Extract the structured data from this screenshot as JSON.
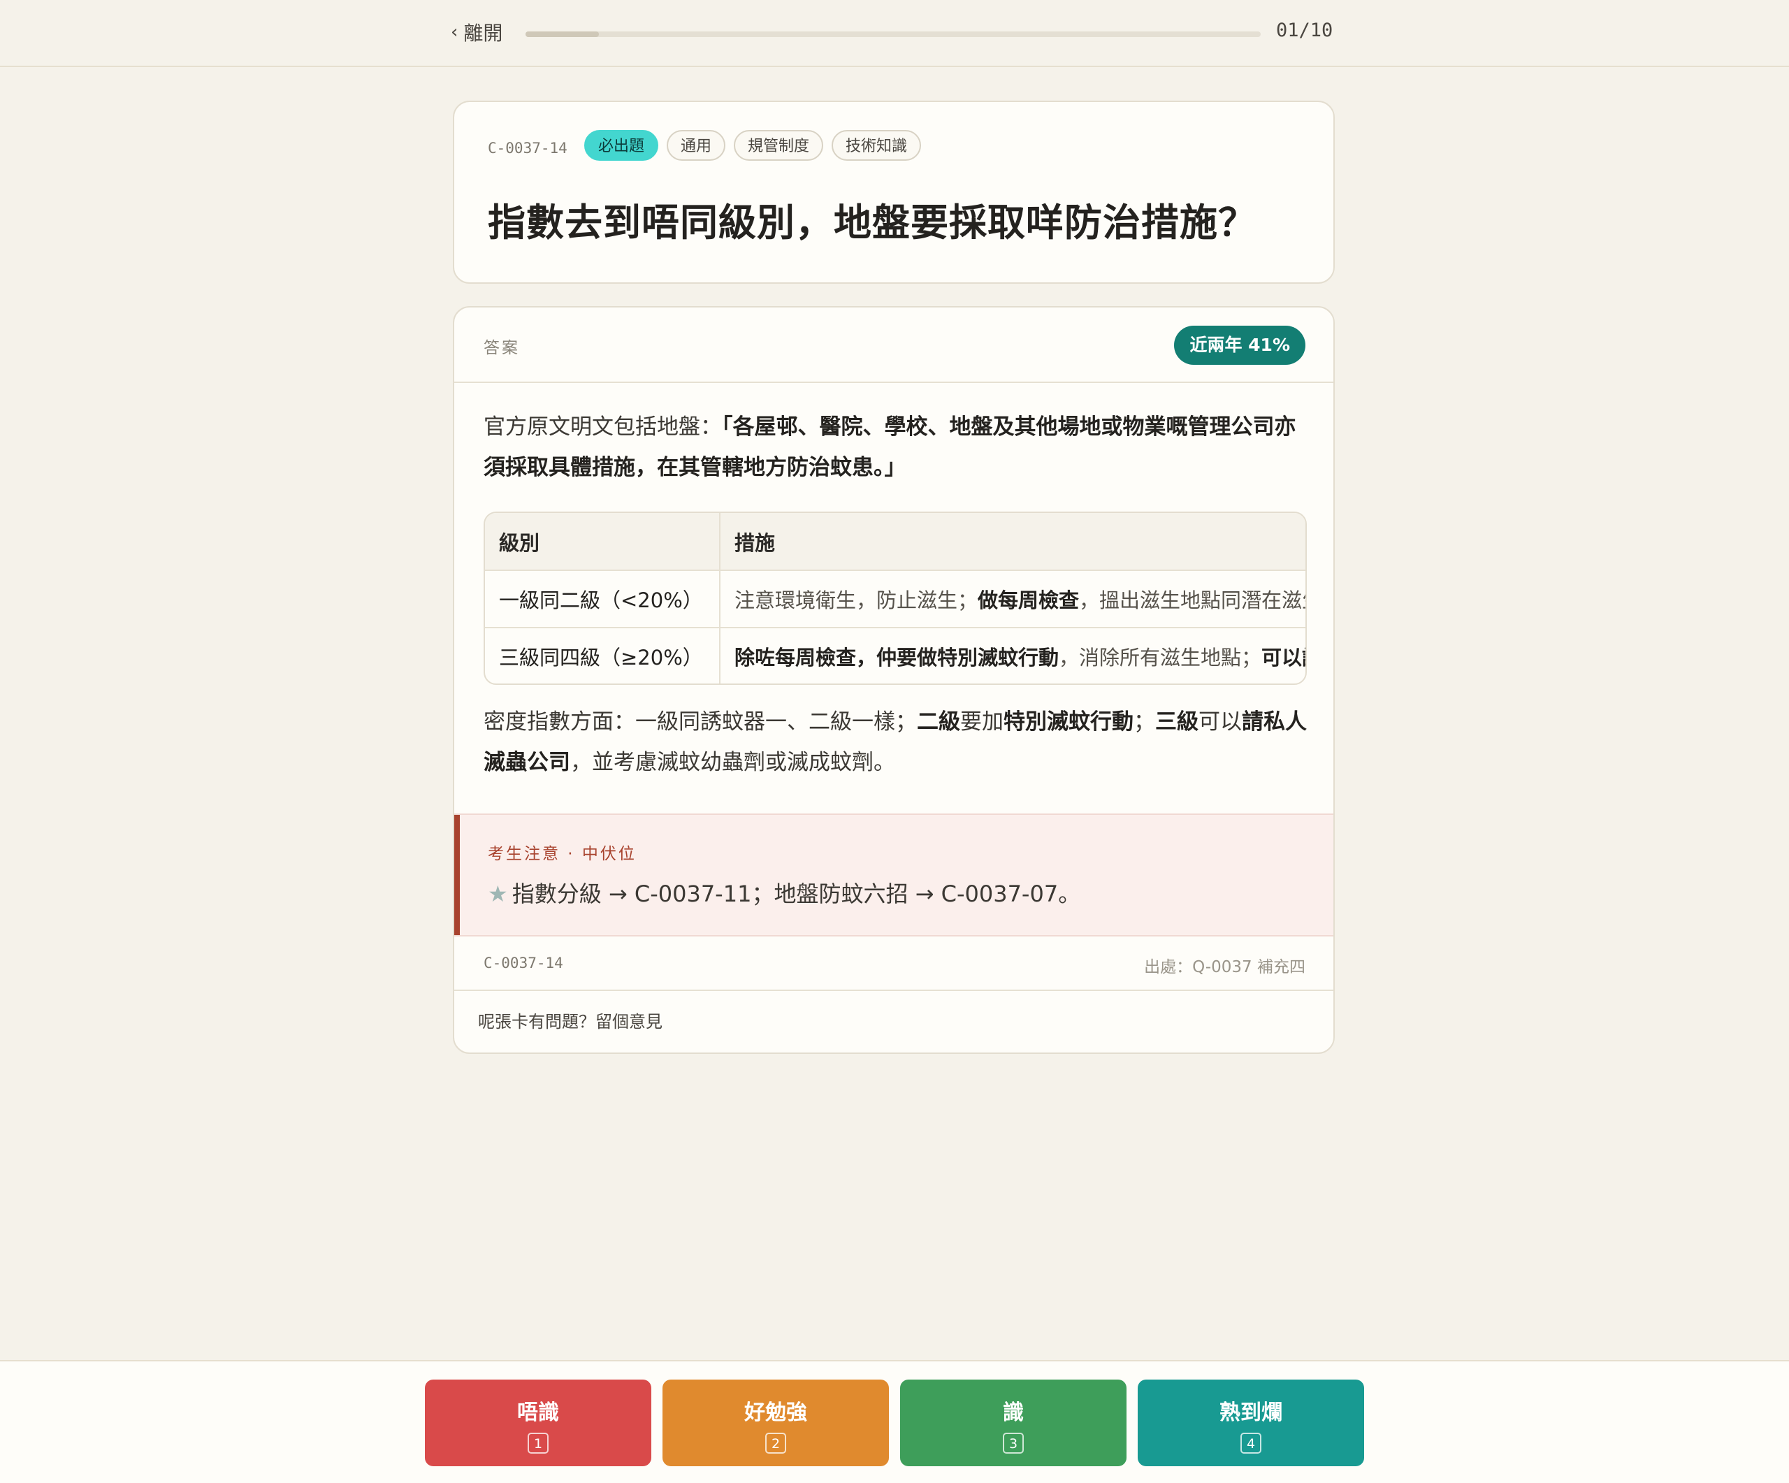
{
  "topbar": {
    "back_label": "離開",
    "progress_counter": "01/10",
    "progress_fraction": 0.1
  },
  "question": {
    "card_id": "C-0037-14",
    "tags": [
      "必出題",
      "通用",
      "規管制度",
      "技術知識"
    ],
    "title": "指數去到唔同級別，地盤要採取咩防治措施？"
  },
  "answer": {
    "label": "答案",
    "rate_badge": "近兩年 41%",
    "para1": {
      "lead": "官方原文明文包括地盤：",
      "quote": "「各屋邨、醫院、學校、地盤及其他場地或物業嘅管理公司亦須採取具體措施，在其管轄地方防治蚊患。」"
    },
    "table": {
      "headers": [
        "級別",
        "措施"
      ],
      "rows": [
        {
          "level": "一級同二級（<20%）",
          "m1": "注意環境衛生，防止滋生；",
          "m2": "做每周檢查",
          "m3": "，搵出滋生地點同潛在滋生地點"
        },
        {
          "level": "三級同四級（≥20%）",
          "m1": "除咗每周檢查，仲要做特別滅蚊行動",
          "m2": "，消除所有滋生地點；",
          "m3": "可以請私人滅蟲公司"
        }
      ]
    },
    "para2": {
      "p1": "密度指數方面：一級同誘蚊器一、二級一樣；",
      "b1": "二級",
      "p2": "要加",
      "b2": "特別滅蚊行動",
      "p3": "；",
      "b3": "三級",
      "p4": "可以",
      "b4": "請私人滅蟲公司",
      "p5": "，並考慮滅蚊幼蟲劑或滅成蚊劑。"
    },
    "note": {
      "title": "考生注意 · 中伏位",
      "text": "指數分級 → C-0037-11；地盤防蚊六招 → C-0037-07。"
    },
    "footer": {
      "card_id": "C-0037-14",
      "source": "出處：Q-0037 補充四"
    },
    "feedback": "呢張卡有問題？留個意見"
  },
  "actions": {
    "again": {
      "label": "唔識",
      "key": "1"
    },
    "hard": {
      "label": "好勉強",
      "key": "2"
    },
    "good": {
      "label": "識",
      "key": "3"
    },
    "easy": {
      "label": "熟到爛",
      "key": "4"
    }
  },
  "colors": {
    "must_tag": "#43d6cf",
    "rate_badge": "#137e73",
    "note_accent": "#a8432e",
    "again": "#d94a4a",
    "hard": "#e08a2e",
    "good": "#3e9e5a",
    "easy": "#189a92"
  }
}
